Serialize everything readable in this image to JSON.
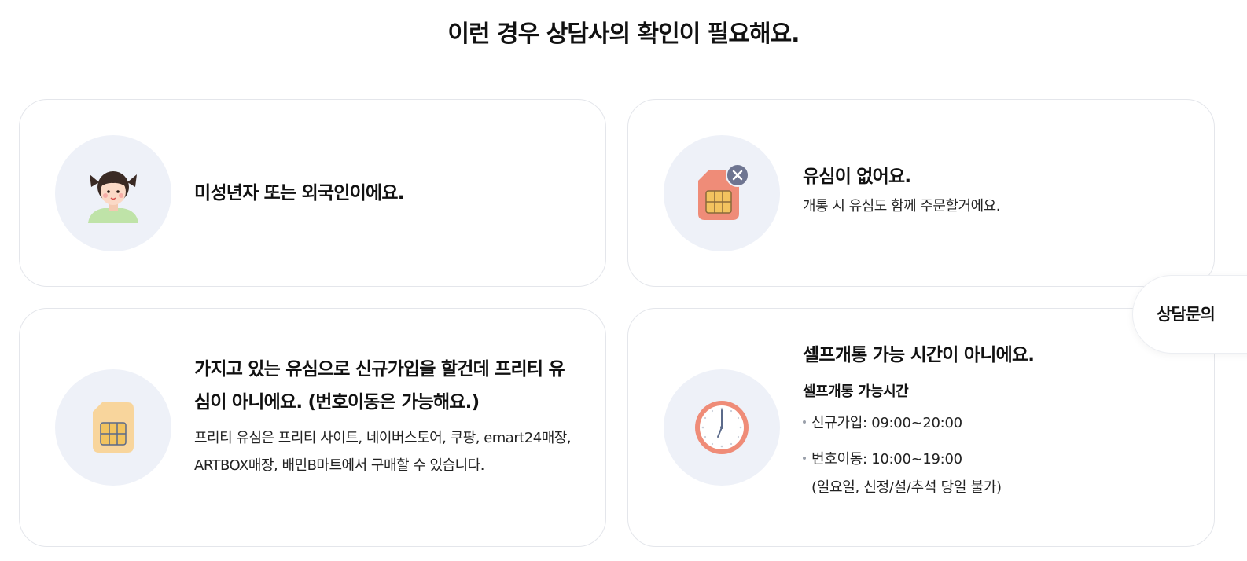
{
  "page": {
    "title": "이런 경우 상담사의 확인이 필요해요."
  },
  "cards": [
    {
      "title": "미성년자 또는 외국인이에요.",
      "icon": "child-avatar-icon"
    },
    {
      "title": "유심이 없어요.",
      "description": "개통 시 유심도 함께 주문할거에요.",
      "icon": "sim-card-unavailable-icon"
    },
    {
      "title": "가지고 있는 유심으로 신규가입을 할건데 프리티 유심이 아니에요. (번호이동은 가능해요.)",
      "description": "프리티 유심은 프리티 사이트, 네이버스토어, 쿠팡, emart24매장, ARTBOX매장, 배민B마트에서 구매할 수 있습니다.",
      "icon": "sim-card-icon"
    },
    {
      "title": "셀프개통 가능 시간이 아니에요.",
      "subtitle": "셀프개통 가능시간",
      "hours": [
        "신규가입: 09:00~20:00",
        "번호이동: 10:00~19:00"
      ],
      "note": "(일요일, 신정/설/추석 당일 불가)",
      "icon": "clock-icon"
    }
  ],
  "floating": {
    "consult_label": "상담문의"
  },
  "colors": {
    "card_border": "#e4e6eb",
    "icon_bg": "#eef1f8",
    "sim_red": "#ef8c78",
    "sim_yellow": "#f8d59c",
    "chip": "#f2c35f",
    "badge": "#6e7591"
  }
}
